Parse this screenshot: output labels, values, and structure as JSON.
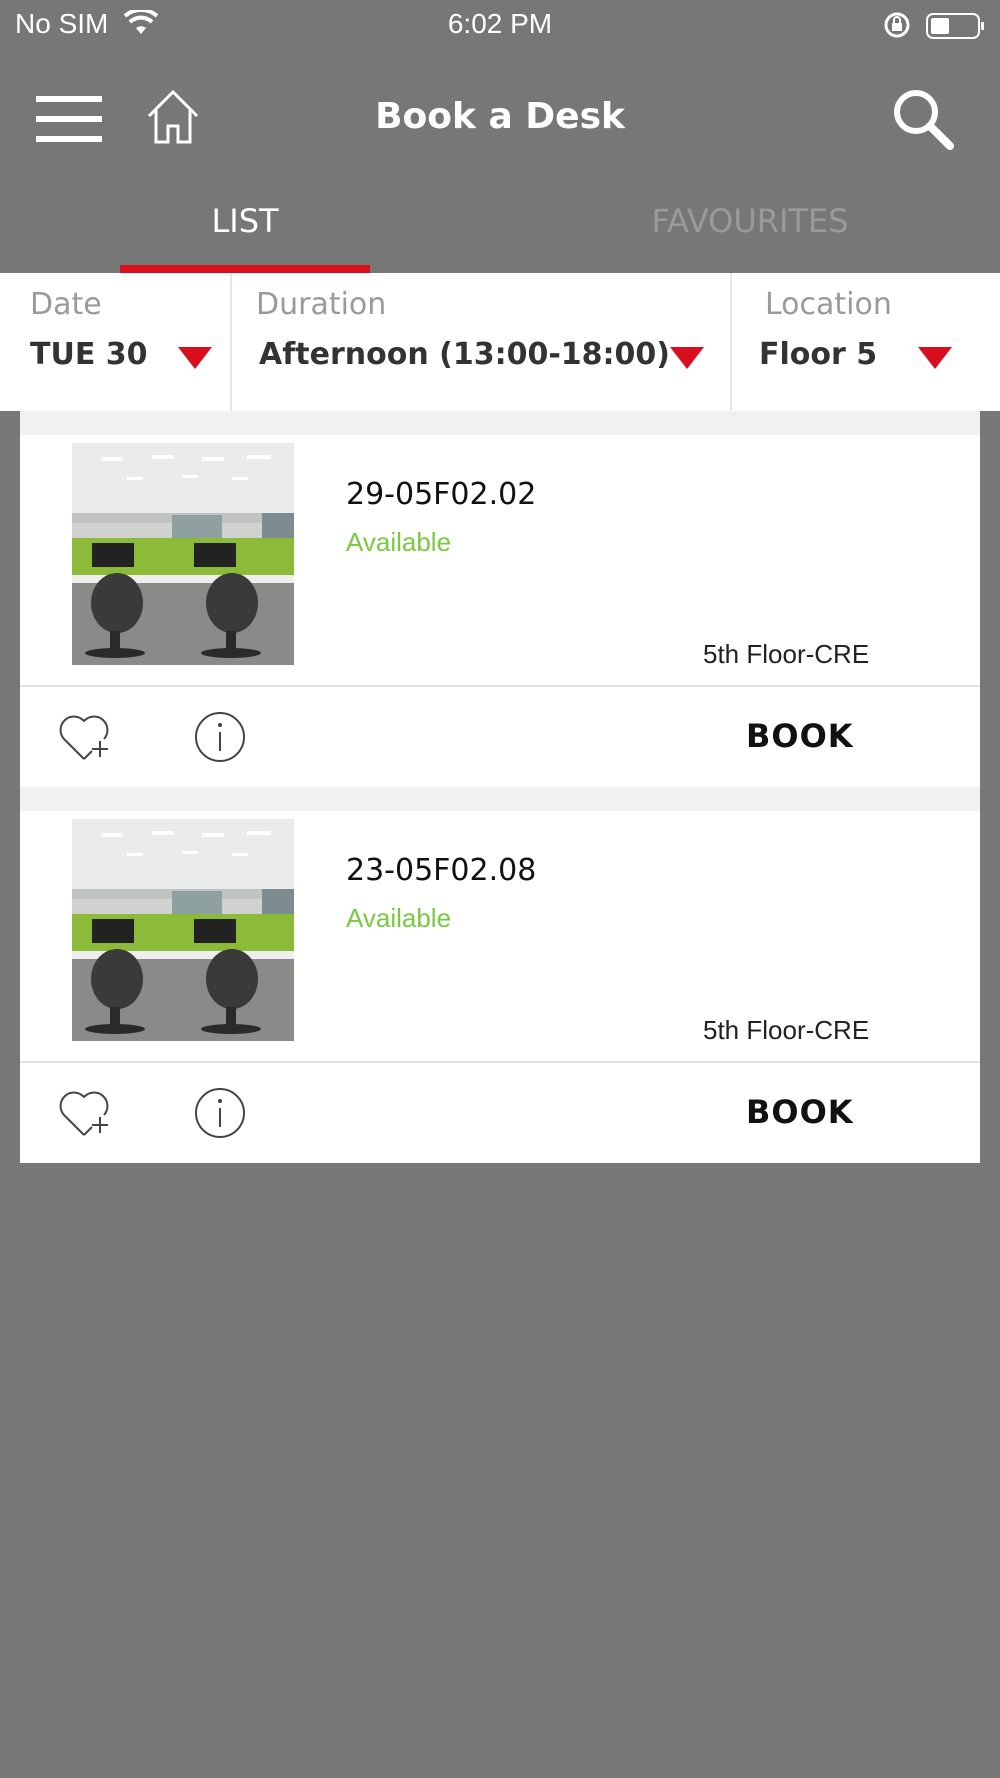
{
  "status_bar": {
    "carrier": "No SIM",
    "time": "6:02 PM"
  },
  "header": {
    "title": "Book a Desk"
  },
  "tabs": [
    {
      "label": "LIST"
    },
    {
      "label": "FAVOURITES"
    }
  ],
  "filters": {
    "date": {
      "label": "Date",
      "value": "TUE 30"
    },
    "duration": {
      "label": "Duration",
      "value": "Afternoon (13:00-18:00)"
    },
    "location": {
      "label": "Location",
      "value": "Floor 5"
    }
  },
  "desks": [
    {
      "id": "29-05F02.02",
      "status": "Available",
      "floor": "5th Floor-CRE",
      "book_label": "BOOK"
    },
    {
      "id": "23-05F02.08",
      "status": "Available",
      "floor": "5th Floor-CRE",
      "book_label": "BOOK"
    }
  ],
  "colors": {
    "accent": "#d90f1e",
    "available": "#7ac943",
    "background": "#777777"
  }
}
